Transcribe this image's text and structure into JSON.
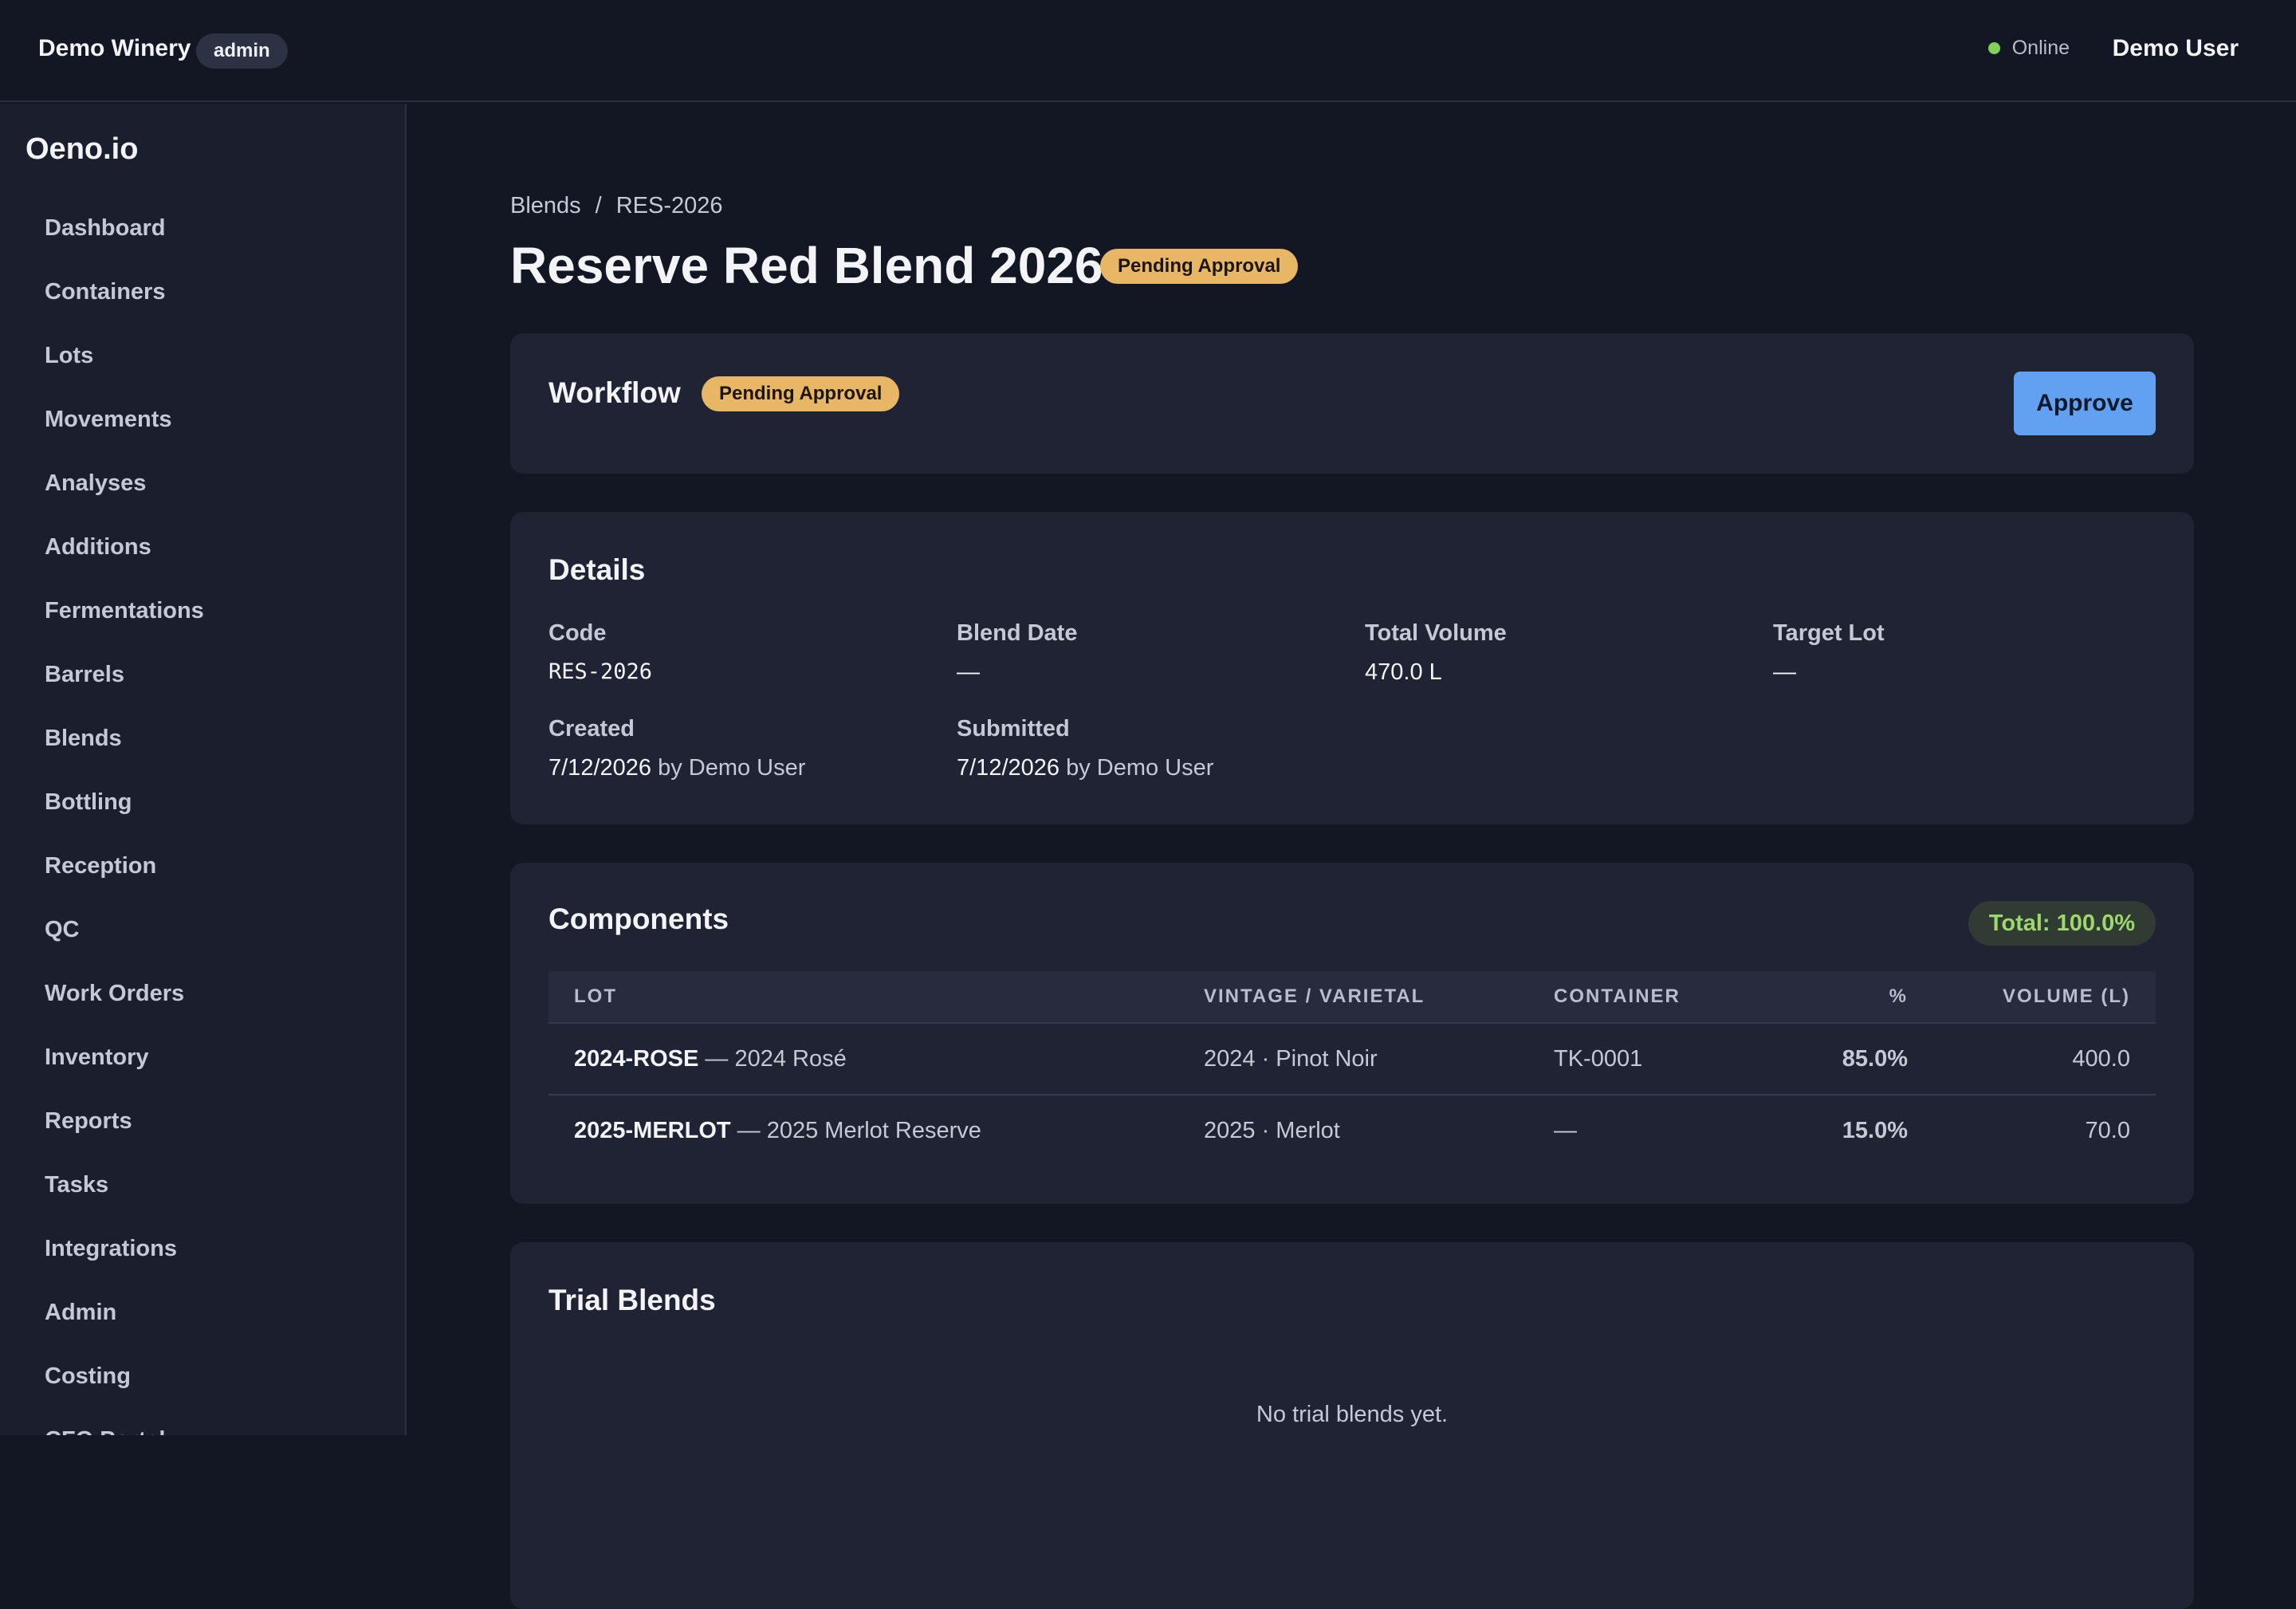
{
  "topbar": {
    "org_name": "Demo Winery",
    "role": "admin",
    "status": "Online",
    "user": "Demo User"
  },
  "sidebar": {
    "brand": "Oeno.io",
    "items": [
      {
        "label": "Dashboard"
      },
      {
        "label": "Containers"
      },
      {
        "label": "Lots"
      },
      {
        "label": "Movements"
      },
      {
        "label": "Analyses"
      },
      {
        "label": "Additions"
      },
      {
        "label": "Fermentations"
      },
      {
        "label": "Barrels"
      },
      {
        "label": "Blends"
      },
      {
        "label": "Bottling"
      },
      {
        "label": "Reception"
      },
      {
        "label": "QC"
      },
      {
        "label": "Work Orders"
      },
      {
        "label": "Inventory"
      },
      {
        "label": "Reports"
      },
      {
        "label": "Tasks"
      },
      {
        "label": "Integrations"
      },
      {
        "label": "Admin"
      },
      {
        "label": "Costing"
      },
      {
        "label": "CFO Portal"
      }
    ]
  },
  "breadcrumb": {
    "parent": "Blends",
    "separator": "/",
    "current": "RES-2026"
  },
  "page": {
    "title": "Reserve Red Blend 2026",
    "status": "Pending Approval"
  },
  "workflow": {
    "title": "Workflow",
    "status": "Pending Approval",
    "approve_label": "Approve"
  },
  "details": {
    "title": "Details",
    "code_label": "Code",
    "code": "RES-2026",
    "blend_date_label": "Blend Date",
    "blend_date": "—",
    "total_volume_label": "Total Volume",
    "total_volume": "470.0 L",
    "target_lot_label": "Target Lot",
    "target_lot": "—",
    "created_label": "Created",
    "created_date": "7/12/2026",
    "created_by": " by Demo User",
    "submitted_label": "Submitted",
    "submitted_date": "7/12/2026",
    "submitted_by": " by Demo User"
  },
  "components": {
    "title": "Components",
    "total": "Total: 100.0%",
    "headers": {
      "lot": "LOT",
      "vintage": "VINTAGE / VARIETAL",
      "container": "CONTAINER",
      "pct": "%",
      "volume": "VOLUME (L)"
    },
    "rows": [
      {
        "lot_code": "2024-ROSE",
        "lot_name": " — 2024 Rosé",
        "vintage": "2024 · Pinot Noir",
        "container": "TK-0001",
        "pct": "85.0%",
        "volume": "400.0"
      },
      {
        "lot_code": "2025-MERLOT",
        "lot_name": " — 2025 Merlot Reserve",
        "vintage": "2025 · Merlot",
        "container": "—",
        "pct": "15.0%",
        "volume": "70.0"
      }
    ]
  },
  "trial": {
    "title": "Trial Blends",
    "empty": "No trial blends yet."
  }
}
